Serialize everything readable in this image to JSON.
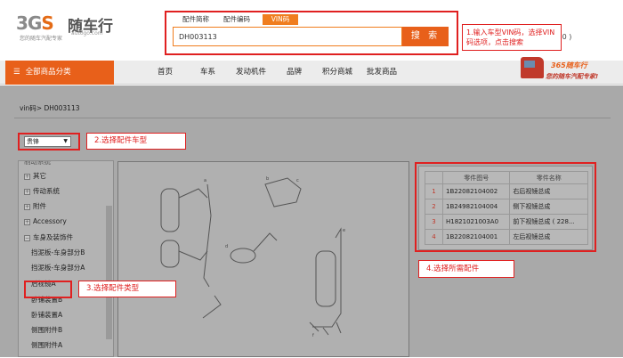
{
  "logo": {
    "mark_gray": "3G",
    "mark_orange": "S",
    "name": "随车行",
    "tagline": "您的随车汽配专家",
    "url": "autogo.com"
  },
  "search": {
    "tabs": [
      "配件简称",
      "配件编码",
      "VIN码"
    ],
    "active_tab": "VIN码",
    "value": "DH003113",
    "button": "搜 索"
  },
  "cart_text": "车( 0 )",
  "nav": {
    "category_label": "全部商品分类",
    "items": [
      "首页",
      "车系",
      "发动机件",
      "品牌",
      "积分商城",
      "批发商品"
    ]
  },
  "promo": {
    "line1": "365随车行",
    "line2": "您的随车汽配专家!"
  },
  "breadcrumb": "vin码> DH003113",
  "model_select": "贵锋",
  "tree": {
    "top_item": "制动系统",
    "items": [
      "其它",
      "传动系统",
      "附件",
      "Accessory",
      "车身及装饰件"
    ],
    "sub_items": [
      "挡泥板-车身部分B",
      "挡泥板-车身部分A",
      "后视镜A",
      "卧铺装置B",
      "卧铺装置A",
      "侧围附件B",
      "侧围附件A"
    ]
  },
  "parts_table": {
    "headers": [
      "零件图号",
      "零件名称"
    ],
    "rows": [
      {
        "idx": "1",
        "code": "1B22082104002",
        "name": "右后视镜总成"
      },
      {
        "idx": "2",
        "code": "1B24982104004",
        "name": "侧下视镜总成"
      },
      {
        "idx": "3",
        "code": "H1821021003A0",
        "name": "前下视镜总成 ( 228..."
      },
      {
        "idx": "4",
        "code": "1B22082104001",
        "name": "左后视镜总成"
      }
    ]
  },
  "callouts": {
    "step1": "1.输入车型VIN码，选择VIN码选项，点击搜索",
    "step2": "2.选择配件车型",
    "step3": "3.选择配件类型",
    "step4": "4.选择所需配件"
  },
  "colors": {
    "accent": "#e8601a",
    "highlight": "#e02020",
    "overlay": "#a9a9a9"
  }
}
